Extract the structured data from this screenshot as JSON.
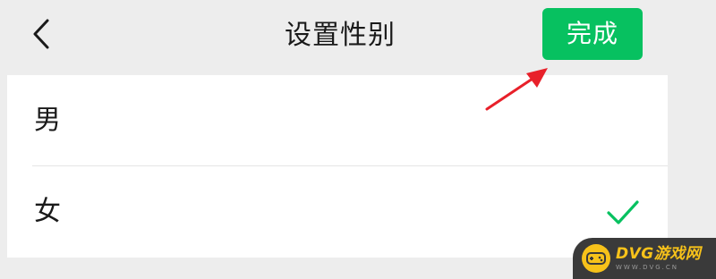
{
  "nav": {
    "back_icon": "chevron-left-icon",
    "title": "设置性别",
    "done_label": "完成"
  },
  "options": [
    {
      "label": "男",
      "selected": false
    },
    {
      "label": "女",
      "selected": true,
      "selected_icon": "checkmark-icon"
    }
  ],
  "annotation": {
    "icon": "red-arrow-annotation"
  },
  "watermark": {
    "name": "DVG游戏网",
    "url": "WWW.DVG.CN",
    "icon": "gamepad-icon"
  },
  "colors": {
    "accent": "#07c160",
    "background": "#ededed",
    "card": "#ffffff",
    "annotation": "#e8202a",
    "watermark_gold": "#f7c21a"
  }
}
